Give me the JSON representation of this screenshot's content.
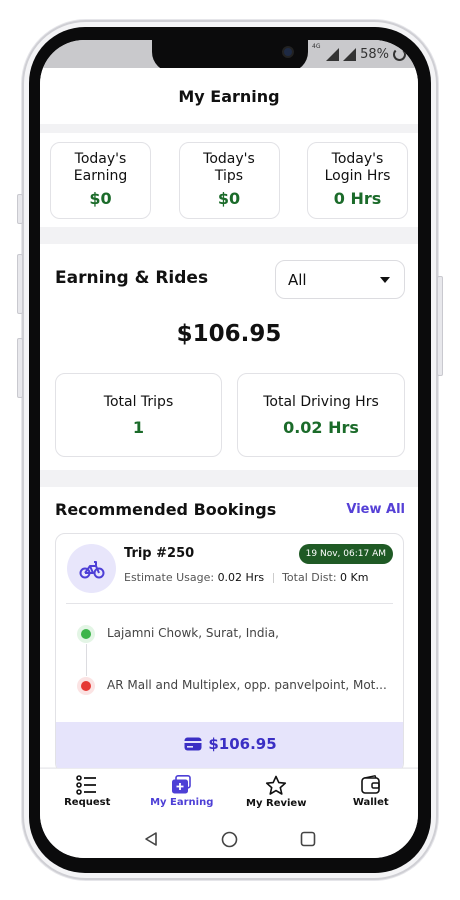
{
  "status_bar": {
    "network": "4G",
    "battery": "58%"
  },
  "header": {
    "title": "My Earning"
  },
  "stats": [
    {
      "label_line1": "Today's",
      "label_line2": "Earning",
      "value": "$0"
    },
    {
      "label_line1": "Today's",
      "label_line2": "Tips",
      "value": "$0"
    },
    {
      "label_line1": "Today's",
      "label_line2": "Login Hrs",
      "value": "0 Hrs"
    }
  ],
  "earning_rides": {
    "title": "Earning & Rides",
    "filter_selected": "All",
    "total_amount": "$106.95",
    "total_trips_label": "Total Trips",
    "total_trips_value": "1",
    "total_driving_label": "Total Driving Hrs",
    "total_driving_value": "0.02 Hrs"
  },
  "recommended": {
    "title": "Recommended Bookings",
    "view_all": "View All",
    "booking": {
      "trip_title": "Trip #250",
      "date": "19 Nov, 06:17 AM",
      "estimate_label": "Estimate Usage:",
      "estimate_value": "0.02 Hrs",
      "dist_label": "Total Dist:",
      "dist_value": "0 Km",
      "pickup": "Lajamni Chowk, Surat, India,",
      "dropoff": "AR Mall and Multiplex, opp. panvelpoint, Mot...",
      "price": "$106.95"
    }
  },
  "bottom_nav": [
    {
      "label": "Request",
      "icon": "list-icon"
    },
    {
      "label": "My Earning",
      "icon": "earning-icon",
      "active": true
    },
    {
      "label": "My Review",
      "icon": "star-icon"
    },
    {
      "label": "Wallet",
      "icon": "wallet-icon"
    }
  ],
  "colors": {
    "accent": "#4d3fd6",
    "value_green": "#1b6b2a",
    "badge_green": "#1f5a25",
    "pickup_dot": "#3db54a",
    "dropoff_dot": "#e53935"
  }
}
